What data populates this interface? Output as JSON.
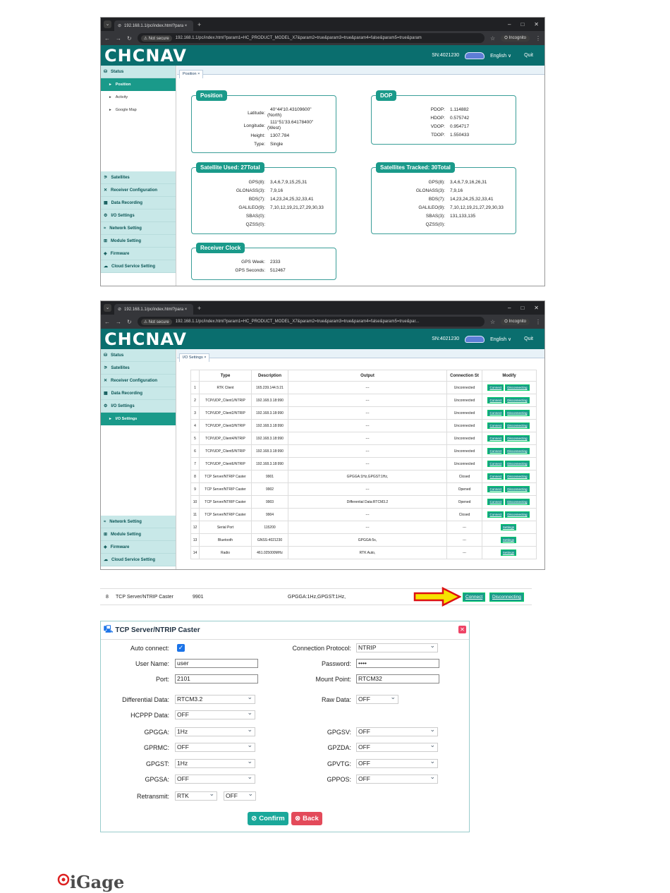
{
  "browser": {
    "tab_title": "192.168.1.1/pc/index.html?para ×",
    "not_secure": "⚠ Not secure",
    "url1": "192.168.1.1/pc/index.html?param1=HC_PRODUCT_MODEL_X7&param2=true&param3=true&param4=false&param5=true&param",
    "url2": "192.168.1.1/pc/index.html?param1=HC_PRODUCT_MODEL_X7&param2=true&param3=true&param4=false&param5=true&par...",
    "incognito": "Incognito"
  },
  "app": {
    "logo": "CHCNAV",
    "serial": "SN:4021230",
    "language": "English ∨",
    "quit": "Quit"
  },
  "shot1": {
    "sidebar_top": [
      {
        "label": "Status",
        "icon": "status-icon"
      }
    ],
    "sub_items": [
      "Position",
      "Activity",
      "Google Map"
    ],
    "sidebar_bottom": [
      "Satellites",
      "Receiver Configuration",
      "Data Recording",
      "I/O Settings",
      "Network Setting",
      "Module Setting",
      "Firmware",
      "Cloud Service Setting"
    ],
    "tab": "Position ×",
    "position": {
      "title": "Position",
      "rows": [
        {
          "k": "Latitude:",
          "v": "40°44'10.43109600\"",
          "v2": "(North)"
        },
        {
          "k": "Longitude:",
          "v": "111°51'33.64178400\"",
          "v2": "(West)"
        },
        {
          "k": "Height:",
          "v": "1307.784"
        },
        {
          "k": "Type:",
          "v": "Single"
        }
      ]
    },
    "dop": {
      "title": "DOP",
      "rows": [
        {
          "k": "PDOP:",
          "v": "1.114882"
        },
        {
          "k": "HDOP:",
          "v": "0.575742"
        },
        {
          "k": "VDOP:",
          "v": "0.954717"
        },
        {
          "k": "TDOP:",
          "v": "1.550433"
        }
      ]
    },
    "sat_used": {
      "title": "Satellite Used:  27Total",
      "rows": [
        {
          "k": "GPS(8):",
          "v": "3,4,6,7,9,15,25,31"
        },
        {
          "k": "GLONASS(3):",
          "v": "7,9,16"
        },
        {
          "k": "BDS(7):",
          "v": "14,23,24,25,32,33,41"
        },
        {
          "k": "GALILEO(9):",
          "v": "7,10,12,19,21,27,29,30,33"
        },
        {
          "k": "SBAS(0):",
          "v": ""
        },
        {
          "k": "QZSS(0):",
          "v": ""
        }
      ]
    },
    "sat_tracked": {
      "title": "Satellites Tracked:  30Total",
      "rows": [
        {
          "k": "GPS(8):",
          "v": "3,4,6,7,9,16,26,31"
        },
        {
          "k": "GLONASS(3):",
          "v": "7,9,16"
        },
        {
          "k": "BDS(7):",
          "v": "14,23,24,25,32,33,41"
        },
        {
          "k": "GALILEO(9):",
          "v": "7,10,12,19,21,27,29,30,33"
        },
        {
          "k": "SBAS(3):",
          "v": "131,133,135"
        },
        {
          "k": "QZSS(0):",
          "v": ""
        }
      ]
    },
    "clock": {
      "title": "Receiver Clock",
      "rows": [
        {
          "k": "GPS Week:",
          "v": "2333"
        },
        {
          "k": "GPS Seconds:",
          "v": "512467"
        }
      ]
    }
  },
  "shot2": {
    "sidebar_top": [
      "Status",
      "Satellites",
      "Receiver Configuration",
      "Data Recording",
      "I/O Settings"
    ],
    "sub_item": "I/O Settings",
    "sidebar_bottom": [
      "Network Setting",
      "Module Setting",
      "Firmware",
      "Cloud Service Setting"
    ],
    "tab": "I/O Settings ×",
    "headers": [
      "",
      "Type",
      "Description",
      "Output",
      "Connection St",
      "Modify"
    ],
    "connect": "Connect",
    "disconnect": "Disconnecting",
    "settings": "Settings",
    "rows": [
      {
        "n": "1",
        "type": "RTK Client",
        "desc": "165.239.144.5:21",
        "out": "---",
        "status": "Unconnected",
        "btn": "cd"
      },
      {
        "n": "2",
        "type": "TCP/UDP_Client1/NTRIP",
        "desc": "192.168.3.18:990",
        "out": "---",
        "status": "Unconnected",
        "btn": "cd"
      },
      {
        "n": "3",
        "type": "TCP/UDP_Client2/NTRIP",
        "desc": "192.168.3.18:990",
        "out": "---",
        "status": "Unconnected",
        "btn": "cd"
      },
      {
        "n": "4",
        "type": "TCP/UDP_Client3/NTRIP",
        "desc": "192.168.3.18:990",
        "out": "---",
        "status": "Unconnected",
        "btn": "cd"
      },
      {
        "n": "5",
        "type": "TCP/UDP_Client4/NTRIP",
        "desc": "192.168.3.18:990",
        "out": "---",
        "status": "Unconnected",
        "btn": "cd"
      },
      {
        "n": "6",
        "type": "TCP/UDP_Client5/NTRIP",
        "desc": "192.168.3.18:990",
        "out": "---",
        "status": "Unconnected",
        "btn": "cd"
      },
      {
        "n": "7",
        "type": "TCP/UDP_Client6/NTRIP",
        "desc": "192.168.3.18:990",
        "out": "---",
        "status": "Unconnected",
        "btn": "cd"
      },
      {
        "n": "8",
        "type": "TCP Server/NTRIP Caster",
        "desc": "9901",
        "out": "GPGGA:1Hz,GPGST:1Hz,",
        "status": "Closed",
        "btn": "cd"
      },
      {
        "n": "9",
        "type": "TCP Server/NTRIP Caster",
        "desc": "9902",
        "out": "---",
        "status": "Opened",
        "btn": "cd"
      },
      {
        "n": "10",
        "type": "TCP Server/NTRIP Caster",
        "desc": "9903",
        "out": "Differential Data:RTCM3.2",
        "status": "Opened",
        "btn": "cd"
      },
      {
        "n": "11",
        "type": "TCP Server/NTRIP Caster",
        "desc": "9904",
        "out": "---",
        "status": "Closed",
        "btn": "cd"
      },
      {
        "n": "12",
        "type": "Serial Port",
        "desc": "115200",
        "out": "---",
        "status": "---",
        "btn": "s"
      },
      {
        "n": "13",
        "type": "Bluetooth",
        "desc": "GNSS-4021230",
        "out": "GPGGA:5s,",
        "status": "---",
        "btn": "s"
      },
      {
        "n": "14",
        "type": "Radio",
        "desc": "461.025000MHz",
        "out": "RTK Auto,",
        "status": "---",
        "btn": "s"
      }
    ]
  },
  "strip": {
    "n": "8",
    "type": "TCP Server/NTRIP Caster",
    "desc": "9901",
    "out": "GPGGA:1Hz,GPGST:1Hz,",
    "connect": "Connect",
    "disconnect": "Disconnecting"
  },
  "dialog": {
    "title": "TCP Server/NTRIP Caster",
    "auto_connect_label": "Auto connect:",
    "protocol_label": "Connection Protocol:",
    "protocol": "NTRIP",
    "user_label": "User Name:",
    "user": "user",
    "password_label": "Password:",
    "password": "••••",
    "port_label": "Port:",
    "port": "2101",
    "mount_label": "Mount Point:",
    "mount": "RTCM32",
    "diff_label": "Differential Data:",
    "diff": "RTCM3.2",
    "raw_label": "Raw Data:",
    "raw": "OFF",
    "hcppp_label": "HCPPP Data:",
    "hcppp": "OFF",
    "gpgga_label": "GPGGA:",
    "gpgga": "1Hz",
    "gpgsv_label": "GPGSV:",
    "gpgsv": "OFF",
    "gprmc_label": "GPRMC:",
    "gprmc": "OFF",
    "gpzda_label": "GPZDA:",
    "gpzda": "OFF",
    "gpgst_label": "GPGST:",
    "gpgst": "1Hz",
    "gpvtg_label": "GPVTG:",
    "gpvtg": "OFF",
    "gpgsa_label": "GPGSA:",
    "gpgsa": "OFF",
    "gppos_label": "GPPOS:",
    "gppos": "OFF",
    "retransmit_label": "Retransmit:",
    "retransmit1": "RTK",
    "retransmit2": "OFF",
    "confirm": "Confirm",
    "back": "Back"
  },
  "footer_logo": "iGage",
  "colors": {
    "brand": "#0a6e6e",
    "accent": "#1a9a8a",
    "arrow": "#f5e300",
    "arrow_border": "#d11"
  }
}
